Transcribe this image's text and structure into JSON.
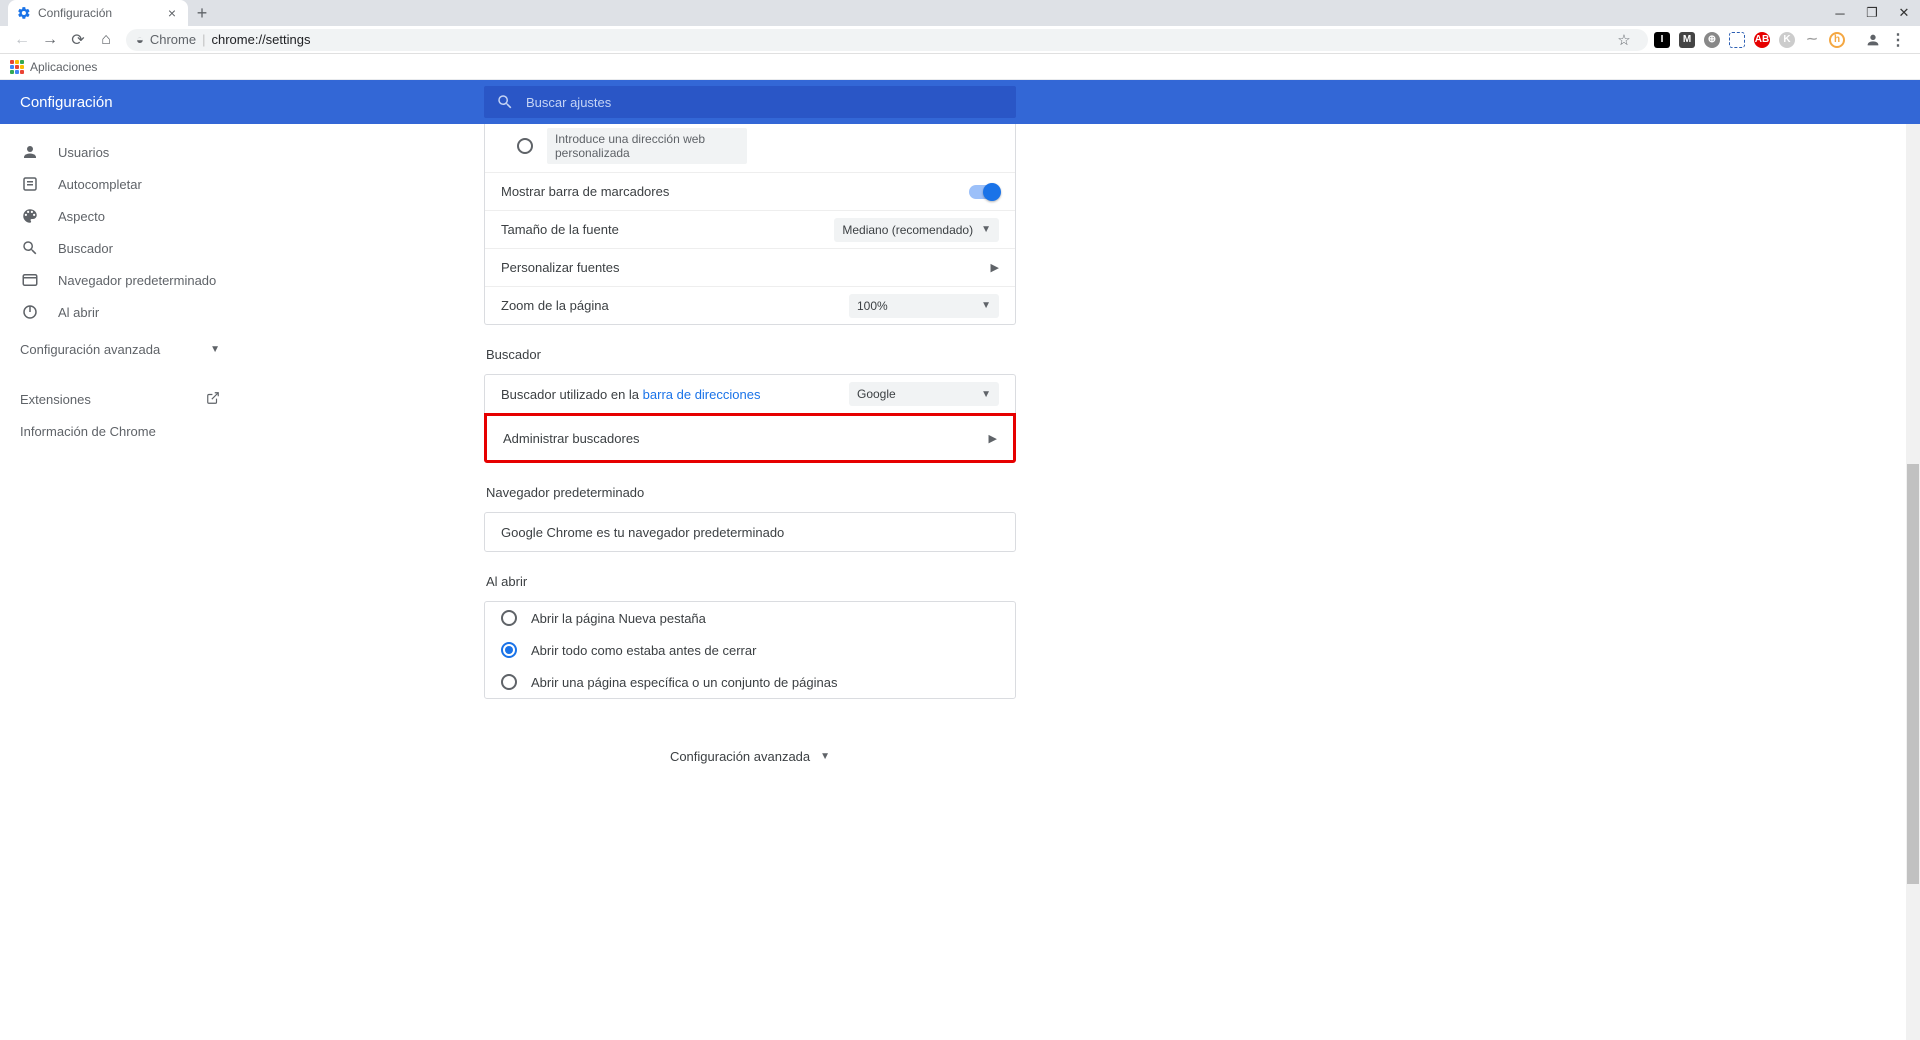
{
  "window": {
    "tab_title": "Configuración",
    "addr_scheme": "Chrome",
    "addr_path": "chrome://settings",
    "bookmarks_apps": "Aplicaciones"
  },
  "header": {
    "title": "Configuración",
    "search_placeholder": "Buscar ajustes"
  },
  "sidebar": {
    "items": [
      {
        "label": "Usuarios"
      },
      {
        "label": "Autocompletar"
      },
      {
        "label": "Aspecto"
      },
      {
        "label": "Buscador"
      },
      {
        "label": "Navegador predeterminado"
      },
      {
        "label": "Al abrir"
      }
    ],
    "advanced": "Configuración avanzada",
    "extensions": "Extensiones",
    "about": "Información de Chrome"
  },
  "main": {
    "custom_addr_placeholder": "Introduce una dirección web personalizada",
    "bookmarks_bar": "Mostrar barra de marcadores",
    "font_size_label": "Tamaño de la fuente",
    "font_size_value": "Mediano (recomendado)",
    "custom_fonts": "Personalizar fuentes",
    "page_zoom_label": "Zoom de la página",
    "page_zoom_value": "100%",
    "search_section": "Buscador",
    "search_used_prefix": "Buscador utilizado en la ",
    "search_used_link": "barra de direcciones",
    "search_engine_value": "Google",
    "manage_search": "Administrar buscadores",
    "default_browser_section": "Navegador predeterminado",
    "default_browser_text": "Google Chrome es tu navegador predeterminado",
    "on_startup_section": "Al abrir",
    "startup_opt1": "Abrir la página Nueva pestaña",
    "startup_opt2": "Abrir todo como estaba antes de cerrar",
    "startup_opt3": "Abrir una página específica o un conjunto de páginas",
    "advanced_center": "Configuración avanzada"
  }
}
